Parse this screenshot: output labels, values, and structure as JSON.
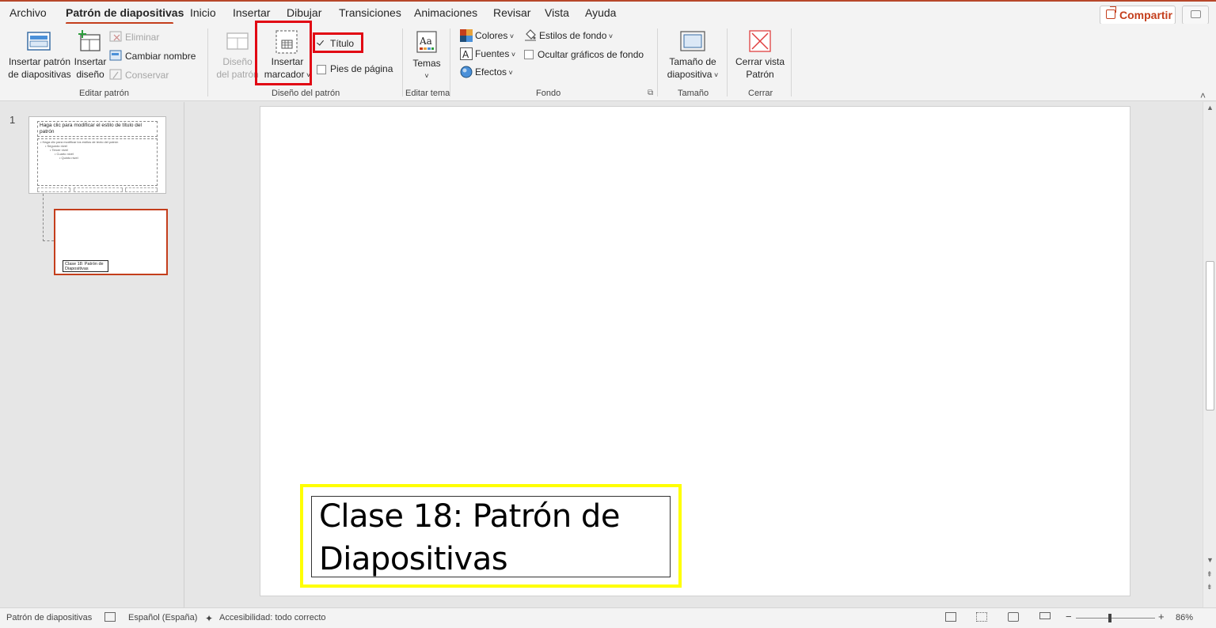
{
  "tabs": [
    "Archivo",
    "Patrón de diapositivas",
    "Inicio",
    "Insertar",
    "Dibujar",
    "Transiciones",
    "Animaciones",
    "Revisar",
    "Vista",
    "Ayuda"
  ],
  "share_label": "Compartir",
  "ribbon": {
    "insert_master": [
      "Insertar patrón",
      "de diapositivas"
    ],
    "insert_layout": [
      "Insertar",
      "diseño"
    ],
    "delete": "Eliminar",
    "rename": "Cambiar nombre",
    "preserve": "Conservar",
    "group_edit": "Editar patrón",
    "master_layout": [
      "Diseño",
      "del patrón"
    ],
    "insert_placeholder": [
      "Insertar",
      "marcador"
    ],
    "title_check": "Título",
    "footers_check": "Pies de página",
    "group_layout": "Diseño del patrón",
    "themes": "Temas",
    "group_theme": "Editar tema",
    "colors": "Colores",
    "fonts": "Fuentes",
    "effects": "Efectos",
    "bg_styles": "Estilos de fondo",
    "hide_bg": "Ocultar gráficos de fondo",
    "group_bg": "Fondo",
    "slide_size": [
      "Tamaño de",
      "diapositiva"
    ],
    "group_size": "Tamaño",
    "close_view": [
      "Cerrar vista",
      "Patrón"
    ],
    "group_close": "Cerrar"
  },
  "thumbs": {
    "number": "1",
    "master_title": "Haga clic para modificar el estilo de título del patrón",
    "master_body": [
      "Haga clic para modificar los estilos de texto del patrón",
      "Segundo nivel",
      "Tercer nivel",
      "Cuarto nivel",
      "Quinto nivel"
    ],
    "layout_title": "Clase 18: Patrón de Diapositivas"
  },
  "slide": {
    "title_line1": "Clase 18: Patrón de",
    "title_line2": "Diapositivas"
  },
  "status": {
    "view": "Patrón de diapositivas",
    "language": "Español (España)",
    "accessibility": "Accesibilidad: todo correcto",
    "zoom": "86%"
  }
}
